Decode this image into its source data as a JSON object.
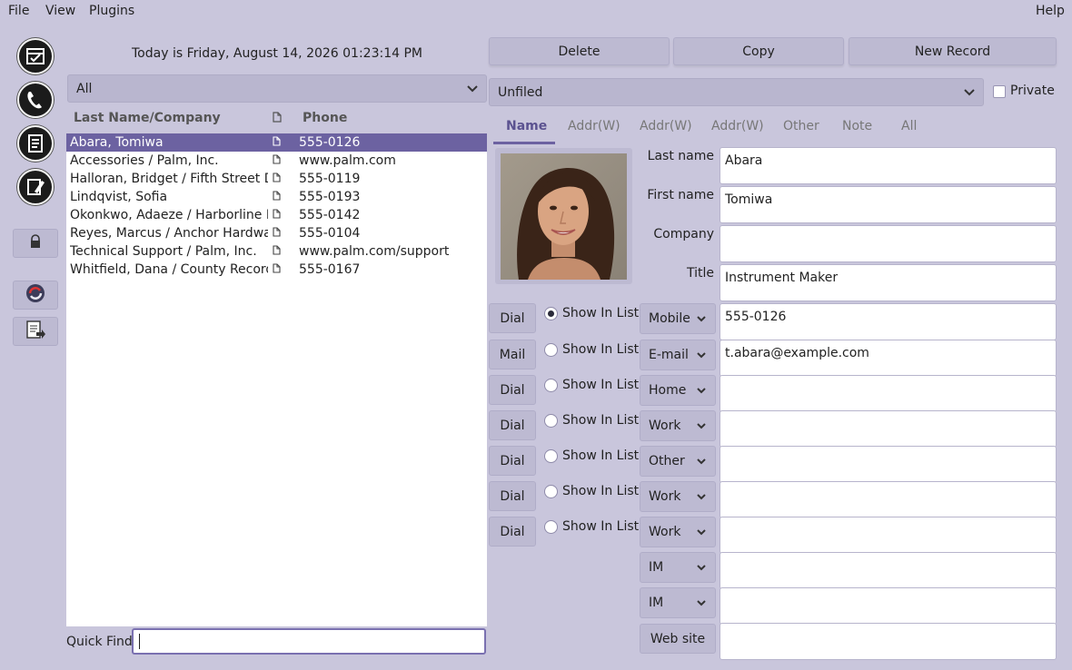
{
  "menu": {
    "file": "File",
    "view": "View",
    "plugins": "Plugins",
    "help": "Help"
  },
  "toolbar": {
    "icons": [
      "datebook-icon",
      "addressbook-icon",
      "todo-icon",
      "memo-icon",
      "lock-icon",
      "sync-icon",
      "export-icon"
    ]
  },
  "date_label": "Today is Friday, August 14, 2026 01:23:14 PM",
  "category_filter": "All",
  "list": {
    "col_name": "Last Name/Company",
    "col_phone": "Phone",
    "rows": [
      {
        "name": "Abara, Tomiwa",
        "phone": "555-0126"
      },
      {
        "name": "Accessories / Palm, Inc.",
        "phone": "www.palm.com"
      },
      {
        "name": "Halloran, Bridget / Fifth Street Den",
        "phone": "555-0119"
      },
      {
        "name": "Lindqvist, Sofia",
        "phone": "555-0193"
      },
      {
        "name": "Okonkwo, Adaeze / Harborline Inst",
        "phone": "555-0142"
      },
      {
        "name": "Reyes, Marcus / Anchor Hardware",
        "phone": "555-0104"
      },
      {
        "name": "Technical Support / Palm, Inc.",
        "phone": "www.palm.com/support"
      },
      {
        "name": "Whitfield, Dana / County Records O",
        "phone": "555-0167"
      }
    ],
    "selected_index": 0
  },
  "quickfind": {
    "label": "Quick Find:",
    "value": ""
  },
  "actions": {
    "delete": "Delete",
    "copy": "Copy",
    "new_record": "New Record"
  },
  "record_category": "Unfiled",
  "private_label": "Private",
  "tabs": [
    "Name",
    "Addr(W)",
    "Addr(W)",
    "Addr(W)",
    "Other",
    "Note",
    "All"
  ],
  "fields": {
    "last_name": {
      "label": "Last name",
      "value": "Abara"
    },
    "first_name": {
      "label": "First name",
      "value": "Tomiwa"
    },
    "company": {
      "label": "Company",
      "value": ""
    },
    "title": {
      "label": "Title",
      "value": "Instrument Maker"
    }
  },
  "phones": [
    {
      "button": "Dial",
      "show": "Show In List",
      "type": "Mobile",
      "value": "555-0126"
    },
    {
      "button": "Mail",
      "show": "Show In List",
      "type": "E-mail",
      "value": "t.abara@example.com"
    },
    {
      "button": "Dial",
      "show": "Show In List",
      "type": "Home",
      "value": ""
    },
    {
      "button": "Dial",
      "show": "Show In List",
      "type": "Work",
      "value": ""
    },
    {
      "button": "Dial",
      "show": "Show In List",
      "type": "Other",
      "value": ""
    },
    {
      "button": "Dial",
      "show": "Show In List",
      "type": "Work",
      "value": ""
    },
    {
      "button": "Dial",
      "show": "Show In List",
      "type": "Work",
      "value": ""
    }
  ],
  "im": [
    {
      "type": "IM",
      "value": ""
    },
    {
      "type": "IM",
      "value": ""
    }
  ],
  "website": {
    "button": "Web site",
    "value": ""
  },
  "colors": {
    "background": "#c9c6dc",
    "selection": "#6c62a1",
    "accent": "#5b5290"
  }
}
